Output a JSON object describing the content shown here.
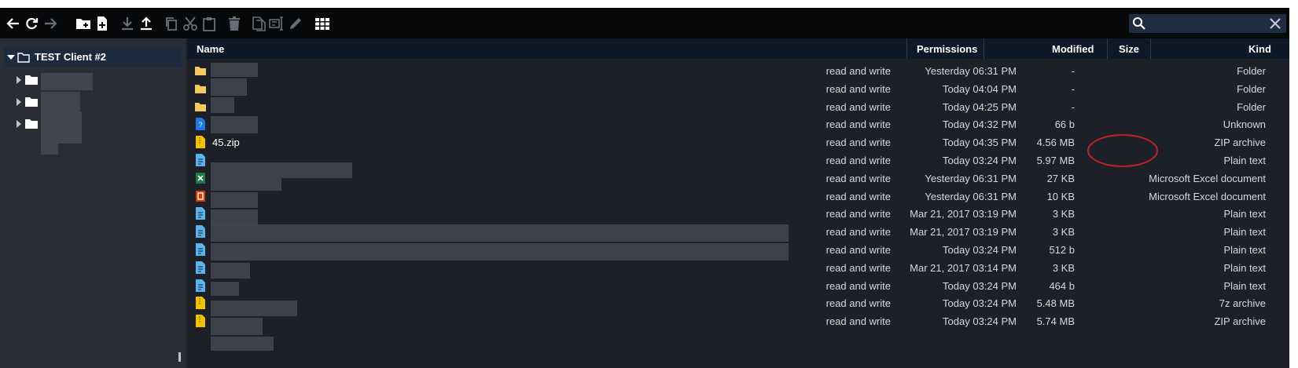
{
  "toolbar": {
    "buttons": [
      {
        "name": "back-icon"
      },
      {
        "name": "refresh-icon"
      },
      {
        "name": "forward-icon"
      },
      {
        "name": "new-folder-icon"
      },
      {
        "name": "new-file-icon"
      },
      {
        "name": "download-icon"
      },
      {
        "name": "upload-icon"
      },
      {
        "name": "copy-icon"
      },
      {
        "name": "cut-icon"
      },
      {
        "name": "paste-icon"
      },
      {
        "name": "delete-icon"
      },
      {
        "name": "duplicate-icon"
      },
      {
        "name": "rename-icon"
      },
      {
        "name": "edit-icon"
      },
      {
        "name": "grid-view-icon"
      }
    ],
    "search": {
      "value": "",
      "placeholder": ""
    }
  },
  "tree": {
    "root_label": "TEST Client #2"
  },
  "columns": {
    "name": "Name",
    "permissions": "Permissions",
    "modified": "Modified",
    "size": "Size",
    "kind": "Kind"
  },
  "files": [
    {
      "icon": "folder",
      "name": "",
      "permissions": "read and write",
      "modified": "Yesterday 06:31 PM",
      "size": "-",
      "kind": "Folder"
    },
    {
      "icon": "folder",
      "name": "",
      "permissions": "read and write",
      "modified": "Today 04:04 PM",
      "size": "-",
      "kind": "Folder"
    },
    {
      "icon": "folder",
      "name": "",
      "permissions": "read and write",
      "modified": "Today 04:25 PM",
      "size": "-",
      "kind": "Folder"
    },
    {
      "icon": "unknown",
      "name": "",
      "permissions": "read and write",
      "modified": "Today 04:32 PM",
      "size": "66 b",
      "kind": "Unknown"
    },
    {
      "icon": "zip",
      "name": "45.zip",
      "permissions": "read and write",
      "modified": "Today 04:35 PM",
      "size": "4.56 MB",
      "kind": "ZIP archive"
    },
    {
      "icon": "text",
      "name": "",
      "permissions": "read and write",
      "modified": "Today 03:24 PM",
      "size": "5.97 MB",
      "kind": "Plain text"
    },
    {
      "icon": "excel",
      "name": "",
      "permissions": "read and write",
      "modified": "Yesterday 06:31 PM",
      "size": "27 KB",
      "kind": "Microsoft Excel document"
    },
    {
      "icon": "office",
      "name": "",
      "permissions": "read and write",
      "modified": "Yesterday 06:31 PM",
      "size": "10 KB",
      "kind": "Microsoft Excel document"
    },
    {
      "icon": "text",
      "name": "",
      "permissions": "read and write",
      "modified": "Mar 21, 2017 03:19 PM",
      "size": "3 KB",
      "kind": "Plain text"
    },
    {
      "icon": "text",
      "name": "",
      "permissions": "read and write",
      "modified": "Mar 21, 2017 03:19 PM",
      "size": "3 KB",
      "kind": "Plain text"
    },
    {
      "icon": "text",
      "name": "",
      "permissions": "read and write",
      "modified": "Today 03:24 PM",
      "size": "512 b",
      "kind": "Plain text"
    },
    {
      "icon": "text",
      "name": "",
      "permissions": "read and write",
      "modified": "Mar 21, 2017 03:14 PM",
      "size": "3 KB",
      "kind": "Plain text"
    },
    {
      "icon": "text",
      "name": "",
      "permissions": "read and write",
      "modified": "Today 03:24 PM",
      "size": "464 b",
      "kind": "Plain text"
    },
    {
      "icon": "archive",
      "name": "",
      "permissions": "read and write",
      "modified": "Today 03:24 PM",
      "size": "5.48 MB",
      "kind": "7z archive"
    },
    {
      "icon": "zip",
      "name": "",
      "permissions": "read and write",
      "modified": "Today 03:24 PM",
      "size": "5.74 MB",
      "kind": "ZIP archive"
    }
  ],
  "colors": {
    "toolbar_bg": "#08090b",
    "header_bg": "#0d1828",
    "list_bg": "#1e2027",
    "tree_bg": "#2b2d35",
    "folder_icon": "#f4c95d",
    "zip_icon": "#f2c200",
    "text_icon": "#5ab4f0",
    "excel_icon": "#1e7a45",
    "office_icon": "#d83b01",
    "highlight_ring": "#c0202a"
  }
}
